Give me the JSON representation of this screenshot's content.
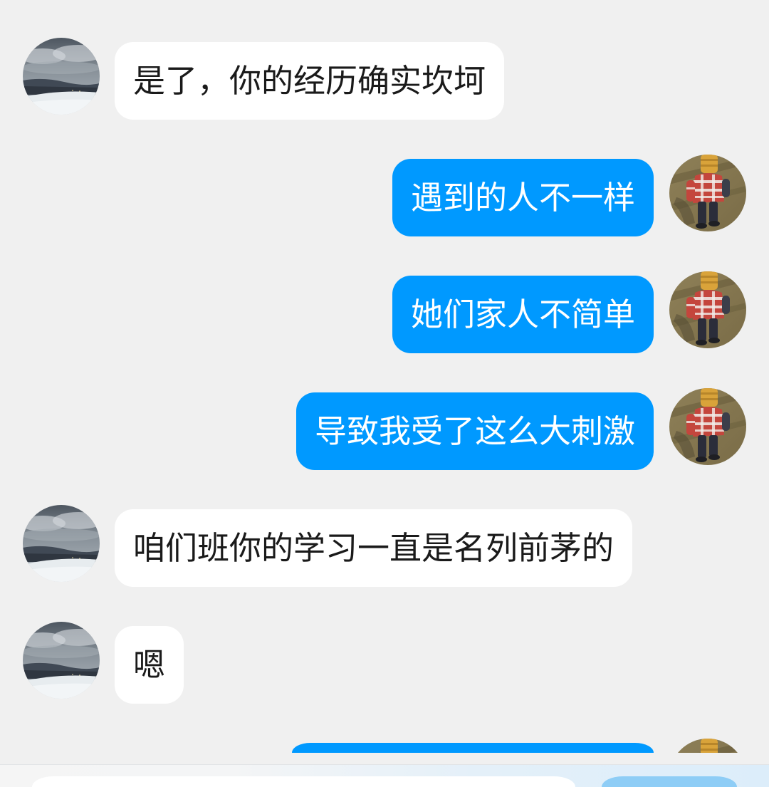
{
  "colors": {
    "background": "#f0f0f0",
    "incoming_bubble": "#ffffff",
    "incoming_text": "#1a1a1a",
    "outgoing_bubble": "#0099ff",
    "outgoing_text": "#ffffff",
    "send_button": "#8ecdf6"
  },
  "messages": [
    {
      "text": "是了，你的经历确实坎坷"
    },
    {
      "text": "遇到的人不一样"
    },
    {
      "text": "她们家人不简单"
    },
    {
      "text": "导致我受了这么大刺激"
    },
    {
      "text": "咱们班你的学习一直是名列前茅的"
    },
    {
      "text": "嗯"
    }
  ]
}
